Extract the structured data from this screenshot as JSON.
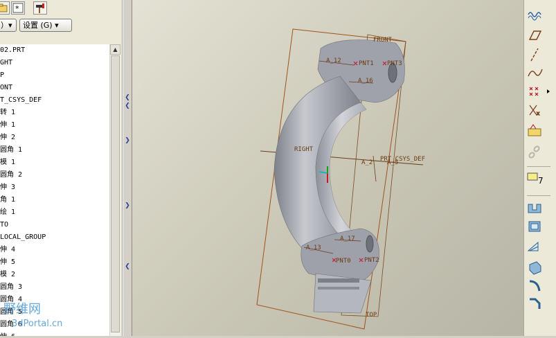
{
  "toolbar": {
    "buttons": [
      {
        "name": "folder-icon"
      },
      {
        "name": "star-icon"
      },
      {
        "name": "hammer-icon"
      }
    ]
  },
  "menu": {
    "partial_label": "）▾",
    "settings_label": "设置 (G) ▾"
  },
  "model_tree": {
    "items": [
      {
        "label": "02.PRT"
      },
      {
        "label": "GHT"
      },
      {
        "label": "P"
      },
      {
        "label": "ONT"
      },
      {
        "label": "T_CSYS_DEF"
      },
      {
        "label": "转 1"
      },
      {
        "label": "伸 1"
      },
      {
        "label": "伸 2"
      },
      {
        "label": "圆角 1"
      },
      {
        "label": "模 1"
      },
      {
        "label": "圆角 2"
      },
      {
        "label": "伸 3"
      },
      {
        "label": "角 1"
      },
      {
        "label": "绘 1"
      },
      {
        "label": "TO"
      },
      {
        "label": "LOCAL_GROUP"
      },
      {
        "label": "伸 4"
      },
      {
        "label": "伸 5"
      },
      {
        "label": "模 2"
      },
      {
        "label": "圆角 3"
      },
      {
        "label": "圆角 4"
      },
      {
        "label": "圆角 5"
      },
      {
        "label": "圆角 6"
      },
      {
        "label": "伸 6"
      }
    ]
  },
  "viewport": {
    "datum_labels": {
      "front": "FRONT",
      "right": "RIGHT",
      "top": "TOP",
      "csys": "PRT_CSYS_DEF",
      "a2": "A_2",
      "a5": "A_5",
      "a12": "A_12",
      "a16": "A_16",
      "a17": "A_17",
      "a13": "A_13",
      "pnt0": "PNT0",
      "pnt1": "PNT1",
      "pnt2": "PNT2",
      "pnt3": "PNT3"
    },
    "colors": {
      "datum_plane": "#a0521b",
      "part_body": "#a9acb4"
    }
  },
  "right_toolbar": {
    "buttons": [
      {
        "name": "curve-sketch-icon"
      },
      {
        "name": "datum-plane-icon"
      },
      {
        "name": "datum-axis-icon"
      },
      {
        "name": "datum-curve-icon"
      },
      {
        "name": "datum-point-icon"
      },
      {
        "name": "coordinate-system-icon"
      },
      {
        "name": "analysis-icon"
      },
      {
        "name": "chain-icon"
      },
      {
        "name": "annotation-icon"
      },
      {
        "name": "extrude-icon"
      },
      {
        "name": "revolve-icon"
      },
      {
        "name": "rib-icon"
      },
      {
        "name": "shell-icon"
      },
      {
        "name": "round-icon"
      },
      {
        "name": "chamfer-icon"
      }
    ]
  },
  "watermark": {
    "brand": "野维网",
    "domain": "3dPortal.cn"
  }
}
